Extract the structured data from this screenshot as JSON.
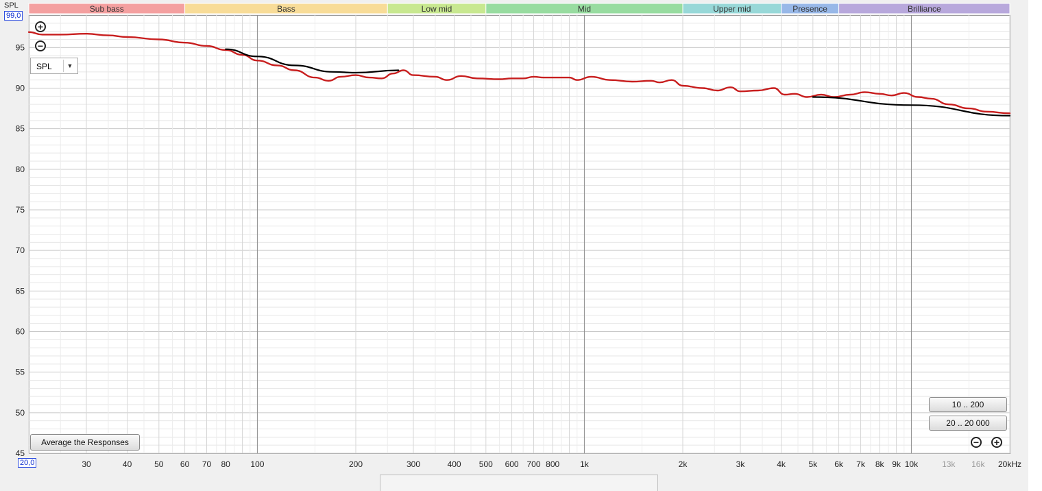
{
  "spl_label": "SPL",
  "y_max_box": "99,0",
  "x_min_box": "20,0",
  "dropdown_value": "SPL",
  "average_button": "Average the Responses",
  "range_buttons": [
    "10 .. 200",
    "20 .. 20 000"
  ],
  "chart_data": {
    "type": "line",
    "x_scale": "log",
    "xlim": [
      20,
      20000
    ],
    "ylim": [
      45,
      99
    ],
    "y_ticks": [
      {
        "value": 95,
        "label": "95"
      },
      {
        "value": 90,
        "label": "90"
      },
      {
        "value": 85,
        "label": "85"
      },
      {
        "value": 80,
        "label": "80"
      },
      {
        "value": 75,
        "label": "75"
      },
      {
        "value": 70,
        "label": "70"
      },
      {
        "value": 65,
        "label": "65"
      },
      {
        "value": 60,
        "label": "60"
      },
      {
        "value": 55,
        "label": "55"
      },
      {
        "value": 50,
        "label": "50"
      },
      {
        "value": 45,
        "label": "45"
      }
    ],
    "x_ticks": [
      {
        "value": 30,
        "label": "30"
      },
      {
        "value": 40,
        "label": "40"
      },
      {
        "value": 50,
        "label": "50"
      },
      {
        "value": 60,
        "label": "60"
      },
      {
        "value": 70,
        "label": "70"
      },
      {
        "value": 80,
        "label": "80"
      },
      {
        "value": 100,
        "label": "100"
      },
      {
        "value": 200,
        "label": "200"
      },
      {
        "value": 300,
        "label": "300"
      },
      {
        "value": 400,
        "label": "400"
      },
      {
        "value": 500,
        "label": "500"
      },
      {
        "value": 600,
        "label": "600"
      },
      {
        "value": 700,
        "label": "700"
      },
      {
        "value": 800,
        "label": "800"
      },
      {
        "value": 1000,
        "label": "1k"
      },
      {
        "value": 2000,
        "label": "2k"
      },
      {
        "value": 3000,
        "label": "3k"
      },
      {
        "value": 4000,
        "label": "4k"
      },
      {
        "value": 5000,
        "label": "5k"
      },
      {
        "value": 6000,
        "label": "6k"
      },
      {
        "value": 7000,
        "label": "7k"
      },
      {
        "value": 8000,
        "label": "8k"
      },
      {
        "value": 9000,
        "label": "9k"
      },
      {
        "value": 10000,
        "label": "10k"
      },
      {
        "value": 13000,
        "label": "13k",
        "dim": true
      },
      {
        "value": 16000,
        "label": "16k",
        "dim": true
      },
      {
        "value": 20000,
        "label": "20kHz"
      }
    ],
    "bands": [
      {
        "name": "Sub bass",
        "from": 20,
        "to": 60,
        "color": "#f4a0a0"
      },
      {
        "name": "Bass",
        "from": 60,
        "to": 250,
        "color": "#f8dc98"
      },
      {
        "name": "Low mid",
        "from": 250,
        "to": 500,
        "color": "#c8e890"
      },
      {
        "name": "Mid",
        "from": 500,
        "to": 2000,
        "color": "#98dca0"
      },
      {
        "name": "Upper mid",
        "from": 2000,
        "to": 4000,
        "color": "#98d8d8"
      },
      {
        "name": "Presence",
        "from": 4000,
        "to": 6000,
        "color": "#98b8e8"
      },
      {
        "name": "Brilliance",
        "from": 6000,
        "to": 20000,
        "color": "#b8a8dc"
      }
    ],
    "series": [
      {
        "color": "#c81e1e",
        "points": [
          [
            20,
            96.9
          ],
          [
            22,
            96.6
          ],
          [
            25,
            96.6
          ],
          [
            30,
            96.7
          ],
          [
            35,
            96.5
          ],
          [
            40,
            96.3
          ],
          [
            50,
            96.0
          ],
          [
            60,
            95.6
          ],
          [
            70,
            95.2
          ],
          [
            80,
            94.7
          ],
          [
            90,
            94.1
          ],
          [
            100,
            93.4
          ],
          [
            115,
            92.8
          ],
          [
            130,
            92.2
          ],
          [
            150,
            91.3
          ],
          [
            165,
            90.9
          ],
          [
            180,
            91.4
          ],
          [
            200,
            91.6
          ],
          [
            220,
            91.3
          ],
          [
            240,
            91.2
          ],
          [
            260,
            91.8
          ],
          [
            280,
            92.2
          ],
          [
            300,
            91.6
          ],
          [
            350,
            91.4
          ],
          [
            380,
            91.0
          ],
          [
            420,
            91.5
          ],
          [
            470,
            91.2
          ],
          [
            550,
            91.1
          ],
          [
            600,
            91.2
          ],
          [
            650,
            91.2
          ],
          [
            700,
            91.4
          ],
          [
            750,
            91.3
          ],
          [
            820,
            91.3
          ],
          [
            900,
            91.3
          ],
          [
            950,
            91.0
          ],
          [
            1050,
            91.4
          ],
          [
            1200,
            91.0
          ],
          [
            1400,
            90.8
          ],
          [
            1600,
            90.9
          ],
          [
            1700,
            90.7
          ],
          [
            1850,
            91.0
          ],
          [
            2000,
            90.3
          ],
          [
            2300,
            90.0
          ],
          [
            2550,
            89.7
          ],
          [
            2800,
            90.1
          ],
          [
            3000,
            89.6
          ],
          [
            3400,
            89.7
          ],
          [
            3800,
            90.0
          ],
          [
            4100,
            89.2
          ],
          [
            4400,
            89.3
          ],
          [
            4800,
            88.9
          ],
          [
            5300,
            89.2
          ],
          [
            5800,
            88.9
          ],
          [
            6500,
            89.2
          ],
          [
            7200,
            89.5
          ],
          [
            8000,
            89.3
          ],
          [
            8700,
            89.1
          ],
          [
            9500,
            89.4
          ],
          [
            10500,
            88.9
          ],
          [
            11500,
            88.7
          ],
          [
            13000,
            88.0
          ],
          [
            15000,
            87.5
          ],
          [
            17000,
            87.1
          ],
          [
            20000,
            86.9
          ]
        ]
      },
      {
        "color": "#000000",
        "points": [
          [
            80,
            94.8
          ],
          [
            100,
            93.9
          ],
          [
            130,
            92.8
          ],
          [
            170,
            92.0
          ],
          [
            200,
            91.9
          ],
          [
            270,
            92.2
          ]
        ]
      },
      {
        "color": "#000000",
        "points": [
          [
            5000,
            88.9
          ],
          [
            10000,
            87.9
          ],
          [
            20000,
            86.6
          ]
        ]
      }
    ]
  }
}
